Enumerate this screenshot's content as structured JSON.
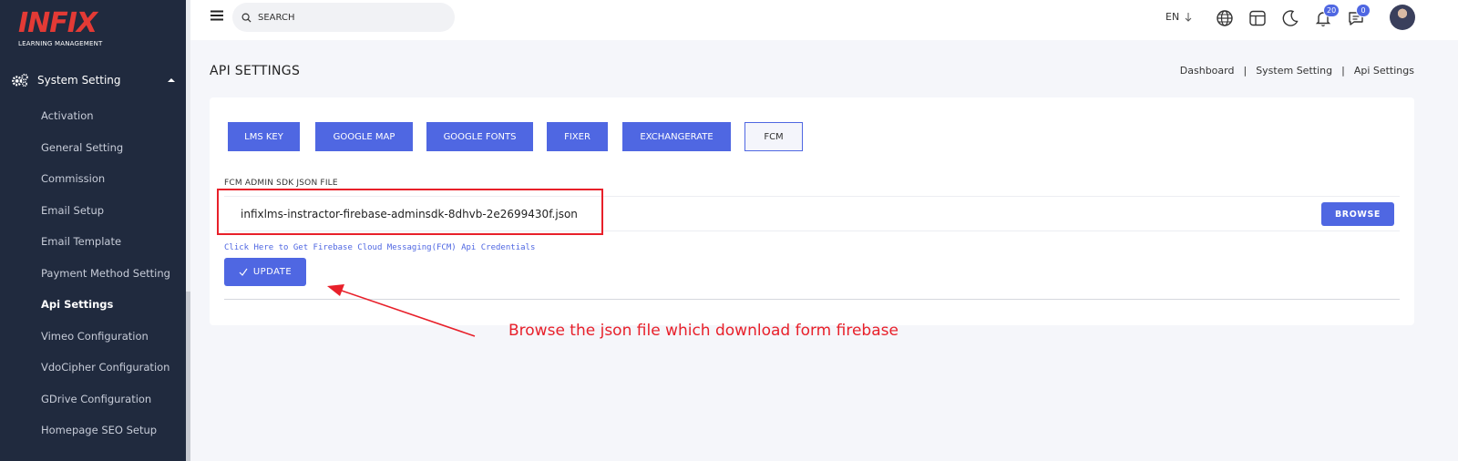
{
  "logo": {
    "mark": "INFIX",
    "subtitle": "LEARNING MANAGEMENT"
  },
  "sidebar": {
    "section_label": "System Setting",
    "items": [
      {
        "label": "Activation",
        "active": false
      },
      {
        "label": "General Setting",
        "active": false
      },
      {
        "label": "Commission",
        "active": false
      },
      {
        "label": "Email Setup",
        "active": false
      },
      {
        "label": "Email Template",
        "active": false
      },
      {
        "label": "Payment Method Setting",
        "active": false
      },
      {
        "label": "Api Settings",
        "active": true
      },
      {
        "label": "Vimeo Configuration",
        "active": false
      },
      {
        "label": "VdoCipher Configuration",
        "active": false
      },
      {
        "label": "GDrive Configuration",
        "active": false
      },
      {
        "label": "Homepage SEO Setup",
        "active": false
      }
    ]
  },
  "topbar": {
    "search_placeholder": "SEARCH",
    "language": "EN",
    "notification_count": "20",
    "message_count": "0",
    "icons": [
      "menu-icon",
      "search-icon",
      "globe-icon",
      "layout-icon",
      "moon-icon",
      "bell-icon",
      "chat-icon"
    ]
  },
  "page": {
    "title": "API SETTINGS",
    "breadcrumb": [
      "Dashboard",
      "System Setting",
      "Api Settings"
    ]
  },
  "tabs": [
    {
      "label": "LMS KEY",
      "active": true
    },
    {
      "label": "GOOGLE MAP",
      "active": true
    },
    {
      "label": "GOOGLE FONTS",
      "active": true
    },
    {
      "label": "FIXER",
      "active": true
    },
    {
      "label": "EXCHANGERATE",
      "active": true
    },
    {
      "label": "FCM",
      "active": false
    }
  ],
  "form": {
    "field_label": "FCM ADMIN SDK JSON FILE",
    "file_value": "infixlms-instractor-firebase-adminsdk-8dhvb-2e2699430f.json",
    "browse_label": "BROWSE",
    "help_link": "Click Here to Get Firebase Cloud Messaging(FCM) Api Credentials",
    "update_label": "UPDATE"
  },
  "annotation": {
    "text": "Browse the json file which download form firebase",
    "color": "#e8202a"
  },
  "colors": {
    "sidebar_bg": "#202a3e",
    "accent": "#4f67e2",
    "logo_red": "#e33a35"
  }
}
